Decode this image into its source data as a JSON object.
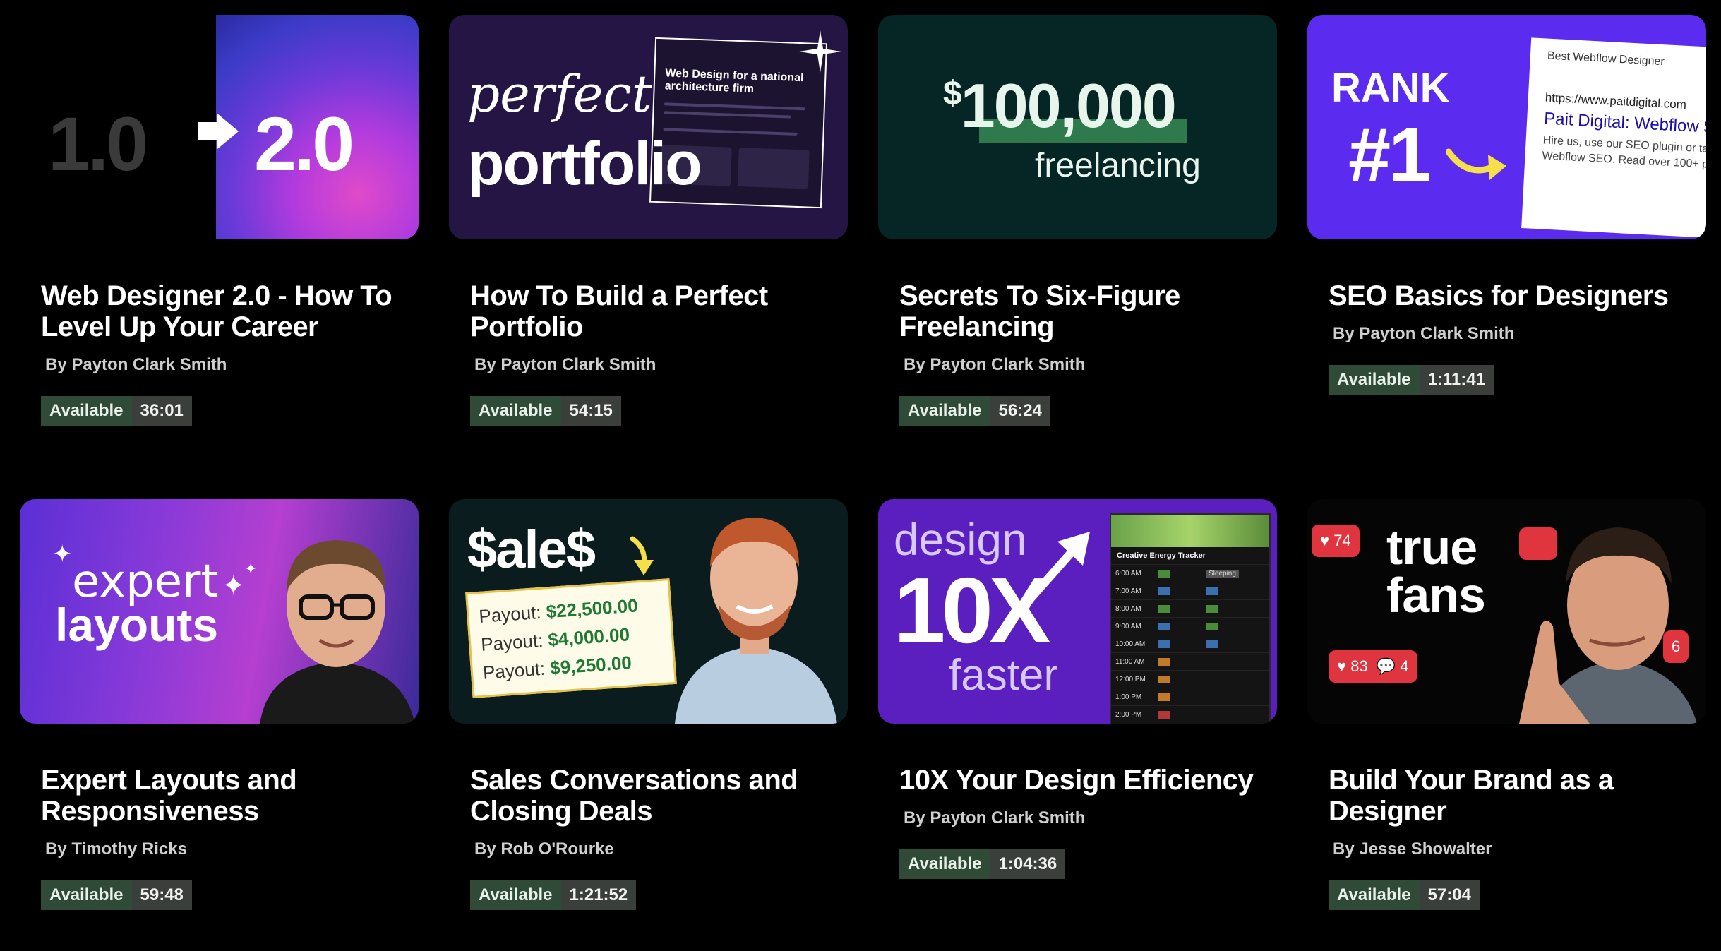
{
  "badge_label": "Available",
  "courses": [
    {
      "title": "Web Designer 2.0 - How To Level Up Your Career",
      "author": "By Payton Clark Smith",
      "status": "Available",
      "duration": "36:01",
      "thumb": {
        "left": "1.0",
        "right": "2.0"
      }
    },
    {
      "title": "How To Build a Perfect Portfolio",
      "author": "By Payton Clark Smith",
      "status": "Available",
      "duration": "54:15",
      "thumb": {
        "line1": "perfect",
        "line2": "portfolio",
        "card_title": "Web Design for a national architecture firm"
      }
    },
    {
      "title": "Secrets To Six-Figure Freelancing",
      "author": "By Payton Clark Smith",
      "status": "Available",
      "duration": "56:24",
      "thumb": {
        "currency": "$",
        "amount": "100,000",
        "sub": "freelancing"
      }
    },
    {
      "title": "SEO Basics for Designers",
      "author": "By Payton Clark Smith",
      "status": "Available",
      "duration": "1:11:41",
      "thumb": {
        "rank": "RANK",
        "number": "#1",
        "query": "Best Webflow Designer",
        "url": "https://www.paitdigital.com",
        "result_title": "Pait Digital: Webflow S",
        "desc1": "Hire us, use our SEO plugin or ta",
        "desc2": "Webflow SEO. Read over 100+ p"
      }
    },
    {
      "title": "Expert Layouts and Responsiveness",
      "author": "By Timothy Ricks",
      "status": "Available",
      "duration": "59:48",
      "thumb": {
        "line1": "expert",
        "line2": "layouts"
      }
    },
    {
      "title": "Sales Conversations and Closing Deals",
      "author": "By Rob O'Rourke",
      "status": "Available",
      "duration": "1:21:52",
      "thumb": {
        "word": "$ale$",
        "payout_label": "Payout:",
        "payouts": [
          "$22,500.00",
          "$4,000.00",
          "$9,250.00"
        ]
      }
    },
    {
      "title": "10X Your Design Efficiency",
      "author": "By Payton Clark Smith",
      "status": "Available",
      "duration": "1:04:36",
      "thumb": {
        "line1": "design",
        "line2": "10X",
        "line3": "faster",
        "tracker_title": "Creative Energy Tracker",
        "times": [
          "6:00 AM",
          "7:00 AM",
          "8:00 AM",
          "9:00 AM",
          "10:00 AM",
          "11:00 AM",
          "12:00 PM",
          "1:00 PM",
          "2:00 PM"
        ],
        "sleeping": "Sleeping"
      }
    },
    {
      "title": "Build Your Brand as a Designer",
      "author": "By Jesse Showalter",
      "status": "Available",
      "duration": "57:04",
      "thumb": {
        "line1": "true",
        "line2": "fans",
        "likes_top": "74",
        "likes_bottom": "83",
        "comments": "4",
        "side": "6"
      }
    }
  ]
}
